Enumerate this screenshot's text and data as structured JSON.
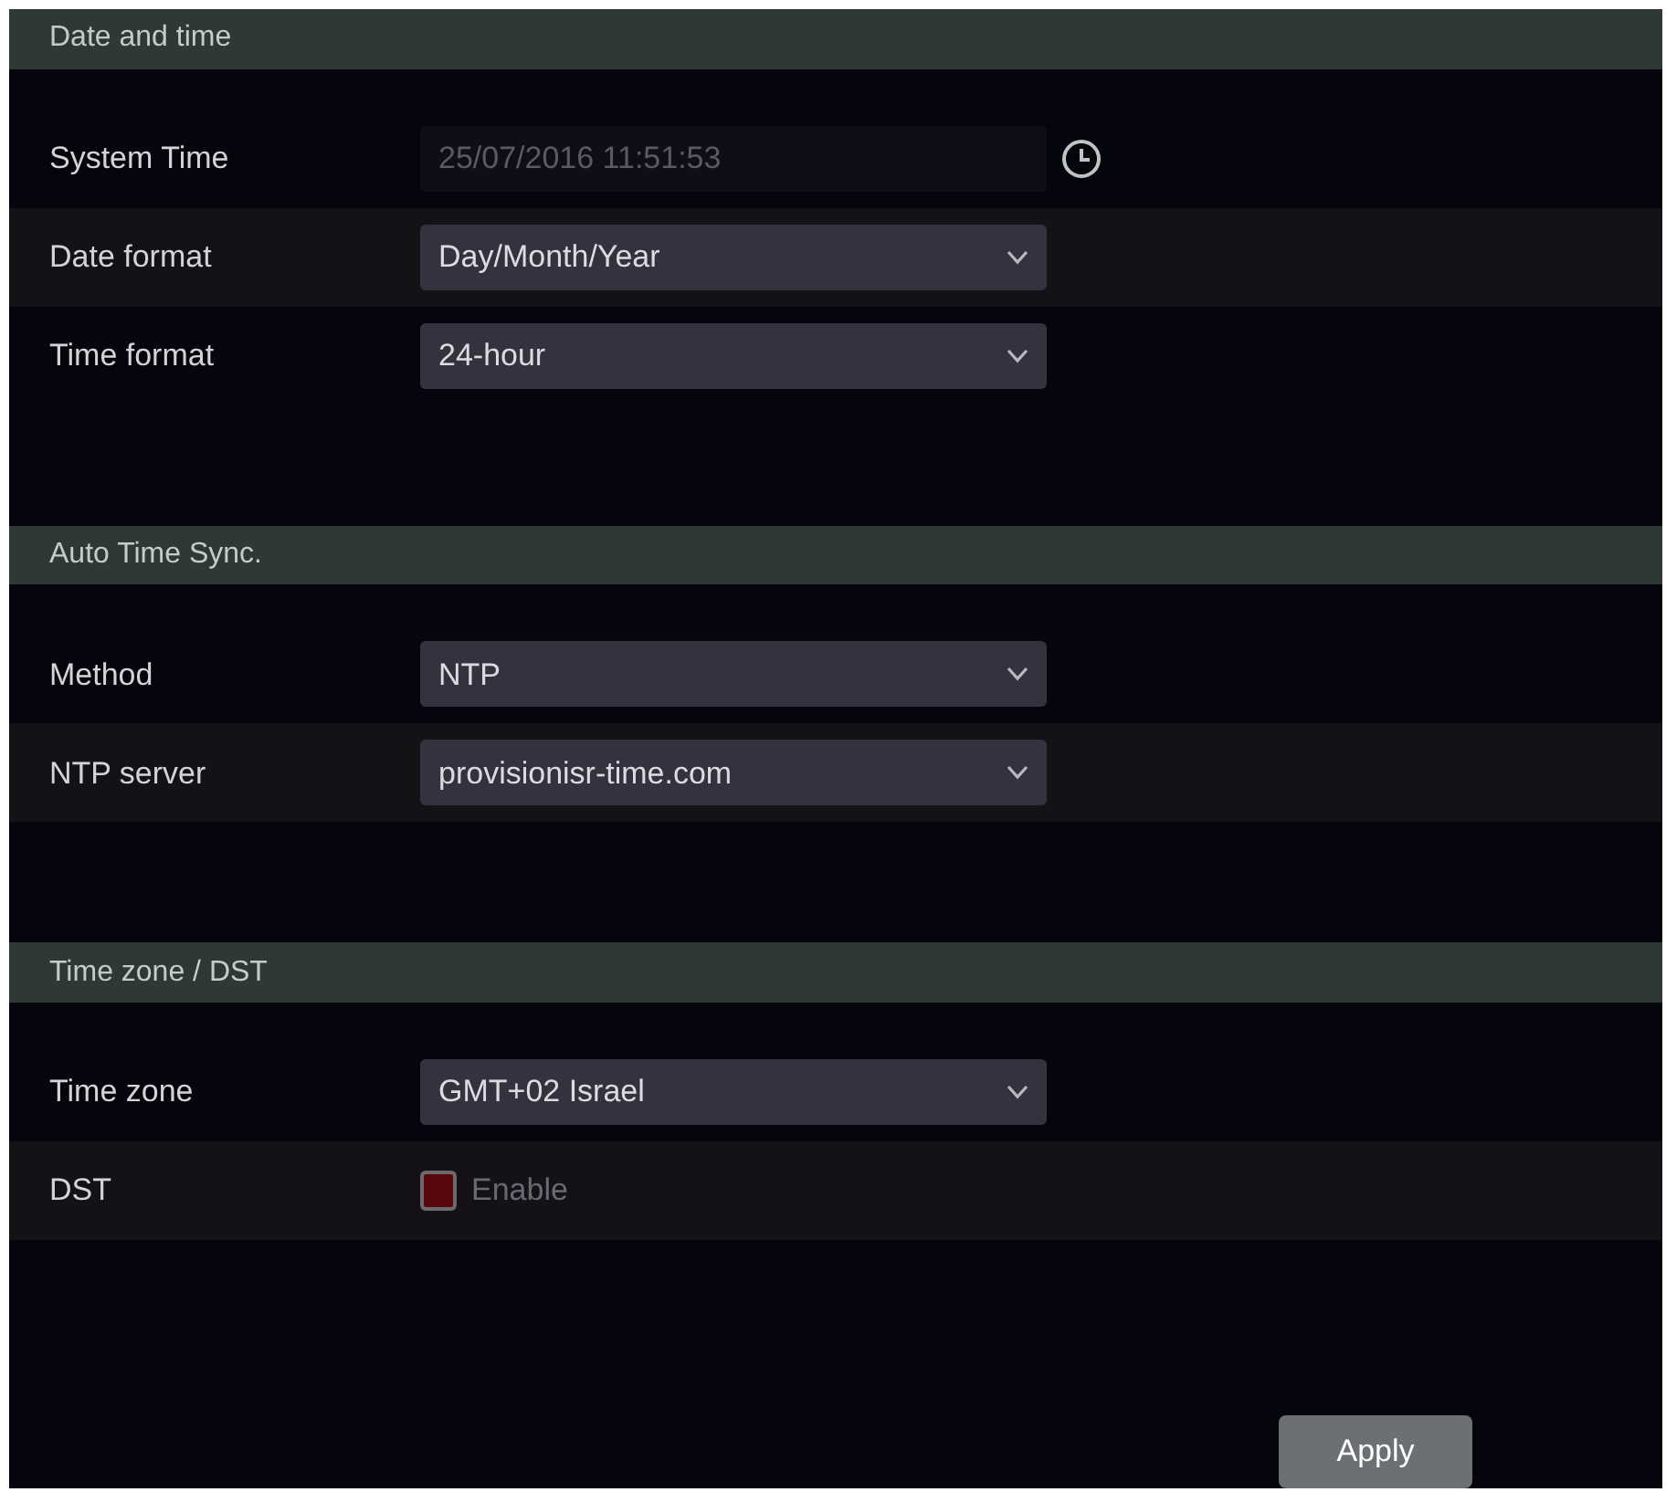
{
  "sections": [
    {
      "title": "Date and time",
      "fields": [
        {
          "kind": "datetime",
          "label": "System Time",
          "value": "25/07/2016 11:51:53",
          "disabled": true
        },
        {
          "kind": "select",
          "label": "Date format",
          "value": "Day/Month/Year"
        },
        {
          "kind": "select",
          "label": "Time format",
          "value": "24-hour"
        }
      ]
    },
    {
      "title": "Auto Time Sync.",
      "fields": [
        {
          "kind": "select",
          "label": "Method",
          "value": "NTP"
        },
        {
          "kind": "select",
          "label": "NTP server",
          "value": "provisionisr-time.com"
        }
      ]
    },
    {
      "title": "Time zone / DST",
      "fields": [
        {
          "kind": "select",
          "label": "Time zone",
          "value": "GMT+02 Israel"
        },
        {
          "kind": "checkbox",
          "label": "DST",
          "option": "Enable",
          "checked": true,
          "disabled": true
        }
      ]
    }
  ],
  "apply_button": {
    "label": "Apply"
  }
}
